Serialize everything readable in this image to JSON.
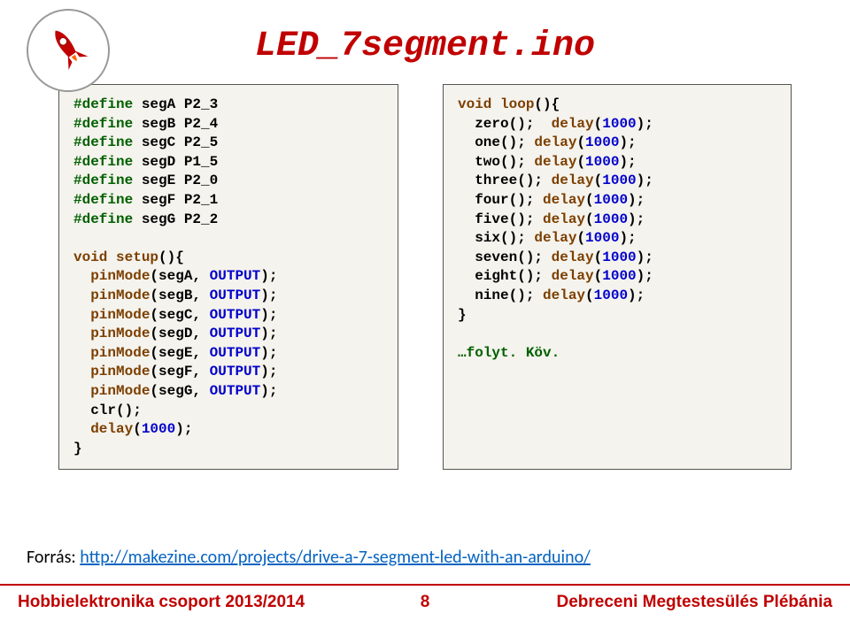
{
  "title": "LED_7segment.ino",
  "codeLeft": {
    "defines": [
      {
        "dir": "#define",
        "name": "segA",
        "val": "P2_3"
      },
      {
        "dir": "#define",
        "name": "segB",
        "val": "P2_4"
      },
      {
        "dir": "#define",
        "name": "segC",
        "val": "P2_5"
      },
      {
        "dir": "#define",
        "name": "segD",
        "val": "P1_5"
      },
      {
        "dir": "#define",
        "name": "segE",
        "val": "P2_0"
      },
      {
        "dir": "#define",
        "name": "segF",
        "val": "P2_1"
      },
      {
        "dir": "#define",
        "name": "segG",
        "val": "P2_2"
      }
    ],
    "setupSig": {
      "void": "void",
      "name": "setup"
    },
    "pins": [
      {
        "fn": "pinMode",
        "arg": "segA",
        "mode": "OUTPUT"
      },
      {
        "fn": "pinMode",
        "arg": "segB",
        "mode": "OUTPUT"
      },
      {
        "fn": "pinMode",
        "arg": "segC",
        "mode": "OUTPUT"
      },
      {
        "fn": "pinMode",
        "arg": "segD",
        "mode": "OUTPUT"
      },
      {
        "fn": "pinMode",
        "arg": "segE",
        "mode": "OUTPUT"
      },
      {
        "fn": "pinMode",
        "arg": "segF",
        "mode": "OUTPUT"
      },
      {
        "fn": "pinMode",
        "arg": "segG",
        "mode": "OUTPUT"
      }
    ],
    "clr": "clr",
    "delay": "delay",
    "delayArg": "1000"
  },
  "codeRight": {
    "void": "void",
    "loop": "loop",
    "calls": [
      {
        "name": "zero",
        "d": "delay",
        "arg": "1000",
        "sp": "  "
      },
      {
        "name": "one",
        "d": "delay",
        "arg": "1000",
        "sp": " "
      },
      {
        "name": "two",
        "d": "delay",
        "arg": "1000",
        "sp": " "
      },
      {
        "name": "three",
        "d": "delay",
        "arg": "1000",
        "sp": " "
      },
      {
        "name": "four",
        "d": "delay",
        "arg": "1000",
        "sp": " "
      },
      {
        "name": "five",
        "d": "delay",
        "arg": "1000",
        "sp": " "
      },
      {
        "name": "six",
        "d": "delay",
        "arg": "1000",
        "sp": " "
      },
      {
        "name": "seven",
        "d": "delay",
        "arg": "1000",
        "sp": " "
      },
      {
        "name": "eight",
        "d": "delay",
        "arg": "1000",
        "sp": " "
      },
      {
        "name": "nine",
        "d": "delay",
        "arg": "1000",
        "sp": " "
      }
    ],
    "cont": "…folyt. Köv."
  },
  "source": {
    "label": "Forrás: ",
    "url": "http://makezine.com/projects/drive-a-7-segment-led-with-an-arduino/"
  },
  "footer": {
    "left": "Hobbielektronika csoport 2013/2014",
    "center": "8",
    "right": "Debreceni Megtestesülés Plébánia"
  }
}
